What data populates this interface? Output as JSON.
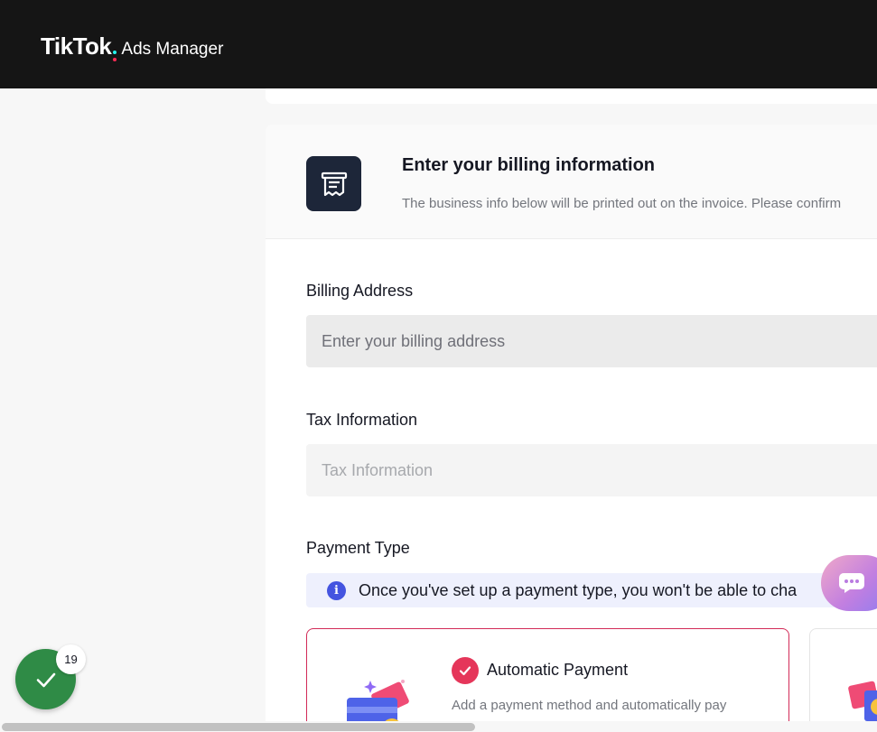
{
  "header": {
    "brand": "TikTok",
    "product": "Ads Manager"
  },
  "billing_card": {
    "title": "Enter your billing information",
    "subtitle": "The business info below will be printed out on the invoice. Please confirm",
    "icon": "receipt-icon"
  },
  "form": {
    "billing_address": {
      "label": "Billing Address",
      "placeholder": "Enter your billing address"
    },
    "tax_information": {
      "label": "Tax Information",
      "placeholder": "Tax Information"
    },
    "payment_type": {
      "label": "Payment Type",
      "notice": "Once you've set up a payment type, you won't be able to cha",
      "options": [
        {
          "title": "Automatic Payment",
          "description": "Add a payment method and automatically pay",
          "selected": true
        },
        {
          "title": "",
          "selected": false
        }
      ]
    }
  },
  "floating": {
    "task_badge_count": "19",
    "chat_icon": "chat-bubble-icon",
    "task_icon": "checkmark-icon"
  },
  "colors": {
    "topbar": "#151515",
    "accent": "#e5365a",
    "header_icon_bg": "#1d2639",
    "info_banner_bg": "#eef0fd",
    "info_icon": "#4454e0",
    "task_button": "#2f8b46"
  }
}
